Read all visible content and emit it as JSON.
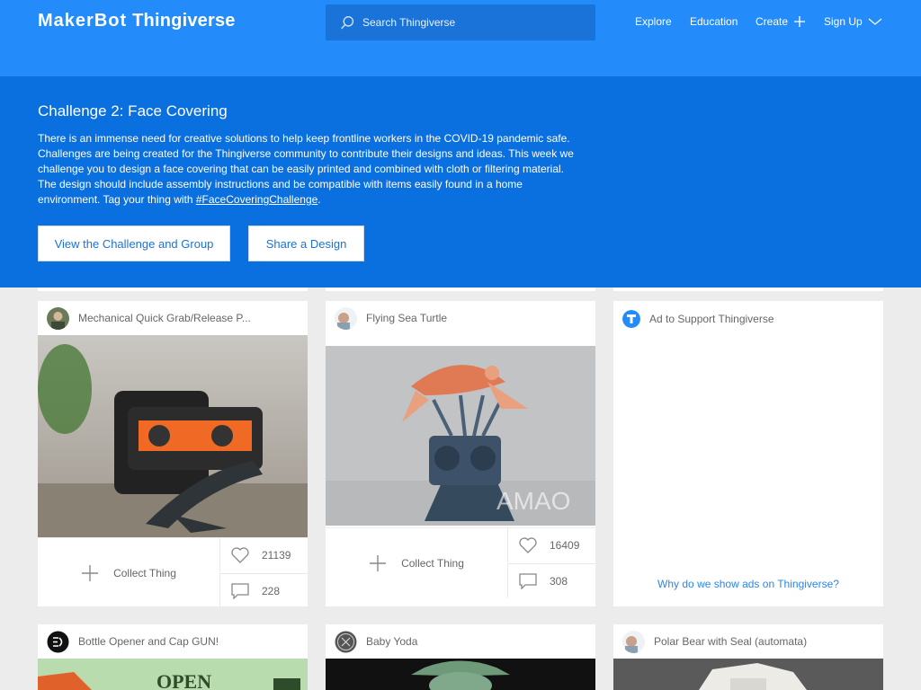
{
  "header": {
    "logo_maker": "MakerBot",
    "logo_thing": "Thingiverse",
    "search_placeholder": "Search Thingiverse",
    "nav": {
      "explore": "Explore",
      "education": "Education",
      "create": "Create",
      "signup": "Sign Up"
    }
  },
  "banner": {
    "title": "Challenge 2: Face Covering",
    "body": "There is an immense need for creative solutions to help keep frontline workers in the COVID-19 pandemic safe. Challenges are being created for the Thingiverse community to contribute their designs and ideas. This week we challenge you to design a face covering that can be easily printed and combined with cloth or filtering material. The design should include assembly instructions and be compatible with items easily found in a home environment. Tag your thing with ",
    "tag": "#FaceCoveringChallenge",
    "tag_suffix": ".",
    "btn_challenge": "View the Challenge and Group",
    "btn_share": "Share a Design"
  },
  "cards": [
    {
      "title": "Mechanical Quick Grab/Release P...",
      "collect_label": "Collect Thing",
      "likes": "21139",
      "comments": "228"
    },
    {
      "title": "Flying Sea Turtle",
      "collect_label": "Collect Thing",
      "likes": "16409",
      "comments": "308"
    }
  ],
  "ad": {
    "title": "Ad to Support Thingiverse",
    "link": "Why do we show ads on Thingiverse?"
  },
  "cards_row2": [
    {
      "title": "Bottle Opener and Cap GUN!",
      "thumb_text": "OPEN"
    },
    {
      "title": "Baby Yoda"
    },
    {
      "title": "Polar Bear with Seal (automata)"
    }
  ],
  "watermark": "AMAO",
  "colors": {
    "brand": "#248bfb",
    "banner": "#0a6fdf",
    "link": "#1a73d9"
  }
}
